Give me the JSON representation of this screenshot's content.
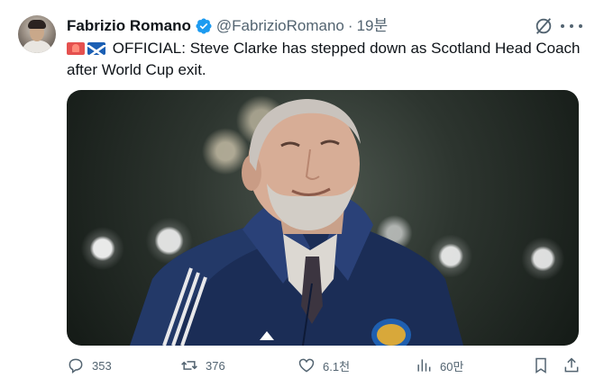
{
  "tweet": {
    "author_name": "Fabrizio Romano",
    "handle": "@FabrizioRomano",
    "separator": "·",
    "time": "19분",
    "text_line1": "OFFICIAL: Steve Clarke has stepped down as Scotland Head Coach",
    "text_line2": "after World Cup exit.",
    "emoji": [
      "alarm-emoji",
      "scotland-flag-emoji"
    ]
  },
  "actions": {
    "replies": "353",
    "retweets": "376",
    "likes": "6.1천",
    "views": "60만"
  },
  "colors": {
    "text_primary": "#0f1419",
    "text_secondary": "#536471",
    "verified_blue": "#1d9bf0",
    "background": "#ffffff"
  },
  "icons": [
    "avatar",
    "verified-badge-icon",
    "grok-icon",
    "more-icon",
    "reply-icon",
    "retweet-icon",
    "like-icon",
    "views-icon",
    "bookmark-icon",
    "share-icon"
  ]
}
